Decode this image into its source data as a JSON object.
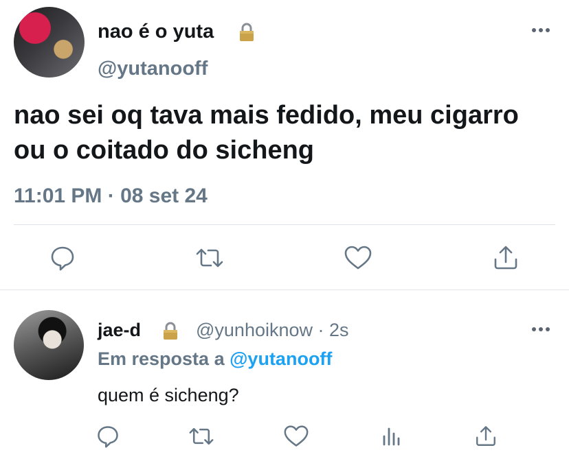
{
  "main_tweet": {
    "display_name": "nao é o yuta",
    "handle": "@yutanooff",
    "text": "nao sei oq tava mais fedido, meu cigarro ou o coitado do sicheng",
    "timestamp": "11:01 PM · 08 set 24",
    "icons": [
      "lock-icon",
      "more-icon",
      "reply-icon",
      "retweet-icon",
      "like-icon",
      "share-icon"
    ]
  },
  "reply_tweet": {
    "display_name": "jae-d",
    "handle_time": "@yunhoiknow · 2s",
    "reply_prefix": "Em resposta a",
    "reply_mention": "@yutanooff",
    "text": "quem é sicheng?",
    "icons": [
      "lock-icon",
      "more-icon",
      "reply-icon",
      "retweet-icon",
      "like-icon",
      "analytics-icon",
      "share-icon"
    ]
  },
  "colors": {
    "text_primary": "#14171a",
    "text_secondary": "#657786",
    "mention": "#1da1f2",
    "icon": "#657786",
    "divider": "#dfe3e7"
  }
}
